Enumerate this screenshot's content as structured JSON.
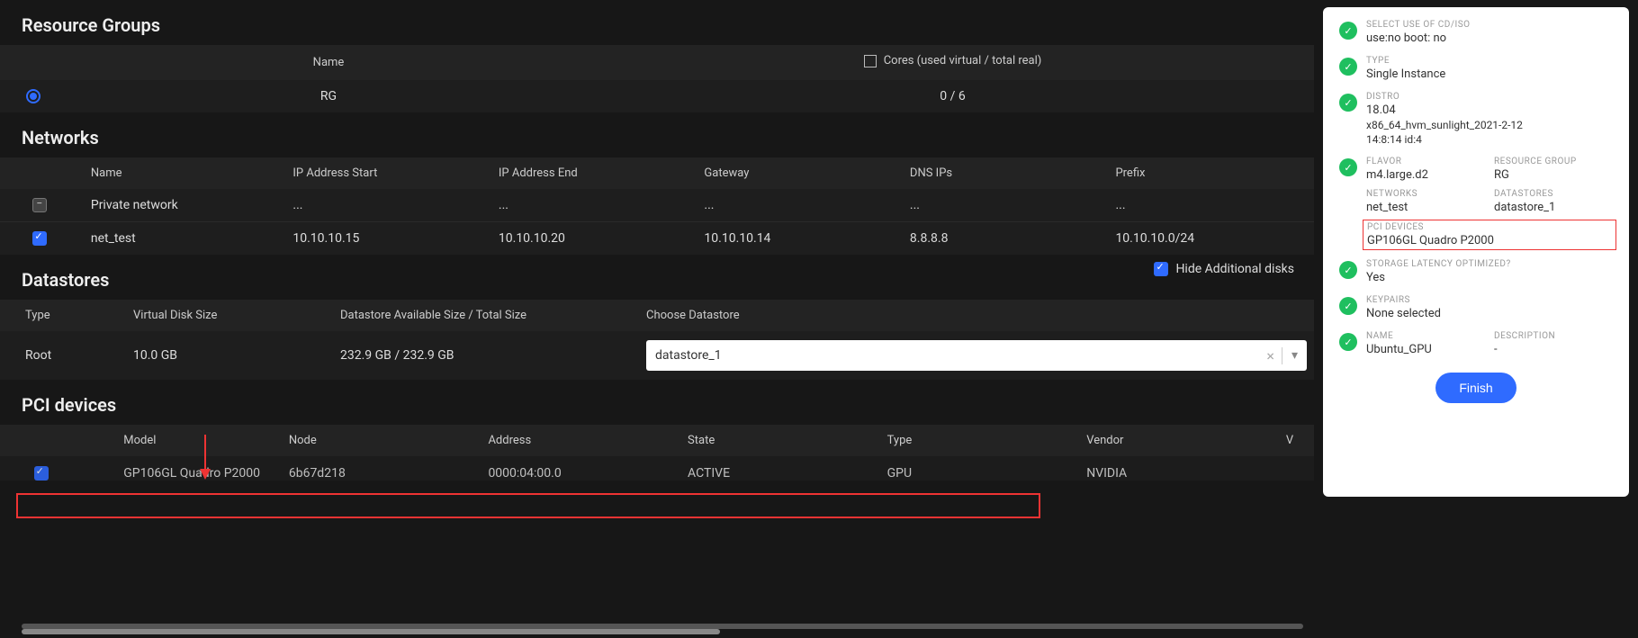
{
  "sections": {
    "resource_groups": {
      "title": "Resource Groups"
    },
    "networks": {
      "title": "Networks"
    },
    "datastores": {
      "title": "Datastores"
    },
    "pci": {
      "title": "PCI devices"
    }
  },
  "rg_table": {
    "headers": {
      "name": "Name",
      "cores": "Cores (used virtual / total real)"
    },
    "row": {
      "name": "RG",
      "cores": "0 / 6"
    }
  },
  "net_table": {
    "headers": {
      "name": "Name",
      "ip_start": "IP Address Start",
      "ip_end": "IP Address End",
      "gateway": "Gateway",
      "dns": "DNS IPs",
      "prefix": "Prefix"
    },
    "rows": [
      {
        "checked": "minus",
        "name": "Private network",
        "ip_start": "...",
        "ip_end": "...",
        "gateway": "...",
        "dns": "...",
        "prefix": "..."
      },
      {
        "checked": "checked",
        "name": "net_test",
        "ip_start": "10.10.10.15",
        "ip_end": "10.10.10.20",
        "gateway": "10.10.10.14",
        "dns": "8.8.8.8",
        "prefix": "10.10.10.0/24"
      }
    ]
  },
  "hide_disks_label": "Hide Additional disks",
  "ds_table": {
    "headers": {
      "type": "Type",
      "vsize": "Virtual Disk Size",
      "avail": "Datastore Available Size / Total Size",
      "choose": "Choose Datastore"
    },
    "row": {
      "type": "Root",
      "vsize": "10.0 GB",
      "avail": "232.9 GB / 232.9 GB",
      "choose_value": "datastore_1"
    }
  },
  "pci_table": {
    "headers": {
      "model": "Model",
      "node": "Node",
      "address": "Address",
      "state": "State",
      "type": "Type",
      "vendor": "Vendor",
      "v": "V"
    },
    "row": {
      "model": "GP106GL Quadro P2000",
      "node": "6b67d218",
      "address": "0000:04:00.0",
      "state": "ACTIVE",
      "type": "GPU",
      "vendor": "NVIDIA"
    }
  },
  "panel": {
    "cdiso": {
      "label": "SELECT USE OF CD/ISO",
      "value": "use:no boot: no"
    },
    "type": {
      "label": "TYPE",
      "value": "Single Instance"
    },
    "distro": {
      "label": "DISTRO",
      "value": "18.04",
      "line2": "x86_64_hvm_sunlight_2021-2-12",
      "line3": "14:8:14 id:4"
    },
    "flavor": {
      "label": "FLAVOR",
      "value": "m4.large.d2"
    },
    "resource_group": {
      "label": "RESOURCE GROUP",
      "value": "RG"
    },
    "networks": {
      "label": "NETWORKS",
      "value": "net_test"
    },
    "datastores": {
      "label": "DATASTORES",
      "value": "datastore_1"
    },
    "pci": {
      "label": "PCI DEVICES",
      "value": "GP106GL Quadro P2000"
    },
    "storage": {
      "label": "STORAGE LATENCY OPTIMIZED?",
      "value": "Yes"
    },
    "keypairs": {
      "label": "KEYPAIRS",
      "value": "None selected"
    },
    "name": {
      "label": "NAME",
      "value": "Ubuntu_GPU"
    },
    "description": {
      "label": "DESCRIPTION",
      "value": "-"
    },
    "finish": "Finish"
  }
}
